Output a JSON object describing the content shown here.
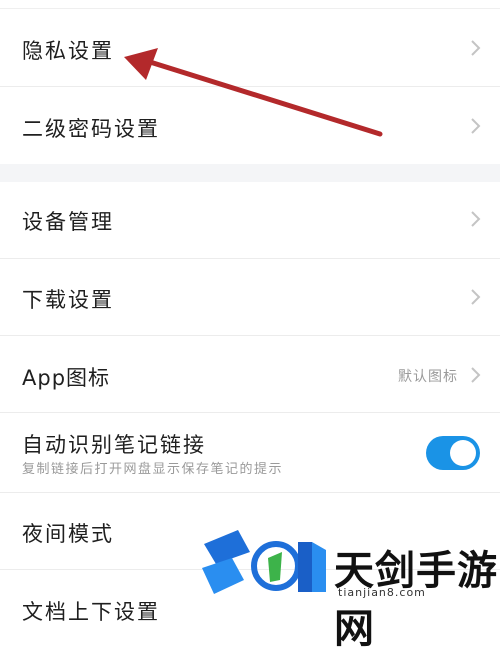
{
  "sections": [
    {
      "items": [
        {
          "label": "隐私设置",
          "has_chevron": true
        },
        {
          "label": "二级密码设置",
          "has_chevron": true
        }
      ]
    },
    {
      "items": [
        {
          "label": "设备管理",
          "has_chevron": true
        },
        {
          "label": "下载设置",
          "has_chevron": true
        },
        {
          "label": "App图标",
          "value": "默认图标",
          "has_chevron": true
        },
        {
          "label": "自动识别笔记链接",
          "description": "复制链接后打开网盘显示保存笔记的提示",
          "toggle_on": true
        },
        {
          "label": "夜间模式"
        },
        {
          "label": "文档上下设置"
        }
      ]
    }
  ],
  "annotation": {
    "type": "red-arrow",
    "color": "#b3292b",
    "points_to": "隐私设置"
  },
  "watermark": {
    "brand": "天剑手游网",
    "url": "tianjian8.com"
  },
  "colors": {
    "accent": "#1a93e6",
    "section_gap": "#f4f5f7",
    "secondary_text": "#9a9a9a"
  }
}
